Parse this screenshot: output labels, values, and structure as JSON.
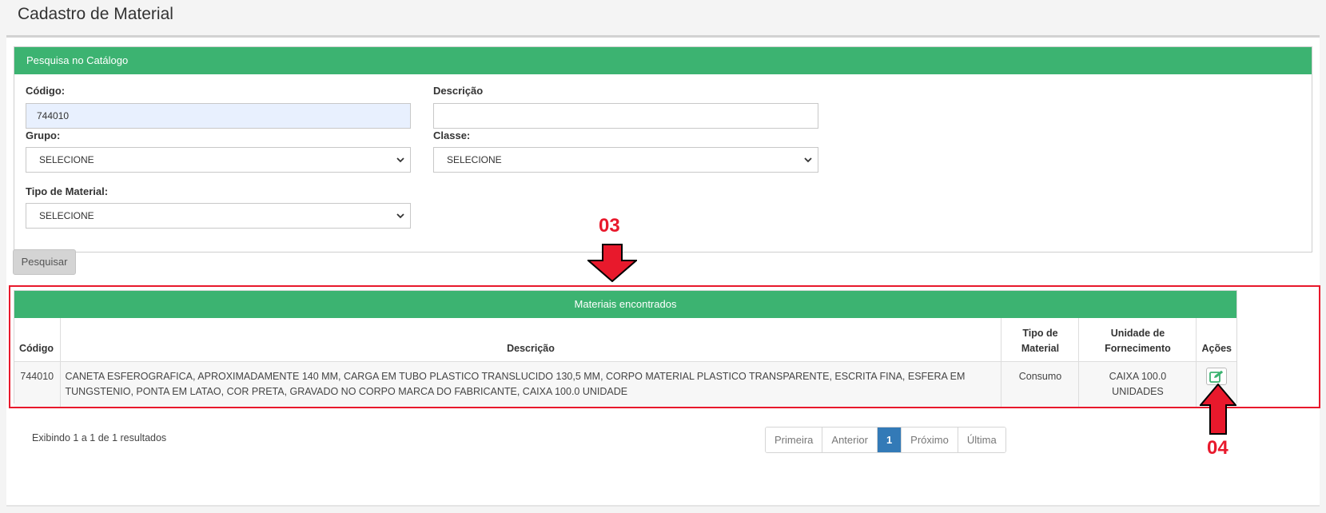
{
  "page": {
    "title": "Cadastro de Material"
  },
  "search_panel": {
    "heading": "Pesquisa no Catálogo",
    "codigo": {
      "label": "Código:",
      "value": "744010"
    },
    "descricao": {
      "label": "Descrição",
      "value": ""
    },
    "grupo": {
      "label": "Grupo:",
      "selected": "SELECIONE"
    },
    "classe": {
      "label": "Classe:",
      "selected": "SELECIONE"
    },
    "tipo_material": {
      "label": "Tipo de Material:",
      "selected": "SELECIONE"
    },
    "search_button": "Pesquisar"
  },
  "results": {
    "heading": "Materiais encontrados",
    "columns": [
      "Código",
      "Descrição",
      "Tipo de Material",
      "Unidade de Fornecimento",
      "Ações"
    ],
    "rows": [
      {
        "codigo": "744010",
        "descricao": "CANETA ESFEROGRAFICA, APROXIMADAMENTE 140 MM, CARGA EM TUBO PLASTICO TRANSLUCIDO 130,5 MM, CORPO MATERIAL PLASTICO TRANSPARENTE, ESCRITA FINA, ESFERA EM TUNGSTENIO, PONTA EM LATAO, COR PRETA, GRAVADO NO CORPO MARCA DO FABRICANTE, CAIXA 100.0 UNIDADE",
        "tipo": "Consumo",
        "unidade": "CAIXA 100.0 UNIDADES",
        "action_icon": "edit-icon"
      }
    ],
    "summary": "Exibindo 1 a 1 de 1 resultados"
  },
  "pagination": {
    "first": "Primeira",
    "previous": "Anterior",
    "current": "1",
    "next": "Próximo",
    "last": "Última"
  },
  "annotations": {
    "label_03": "03",
    "label_04": "04",
    "highlight_color": "#e8192c"
  },
  "colors": {
    "accent_green": "#3cb371",
    "pagination_active": "#337ab7"
  }
}
